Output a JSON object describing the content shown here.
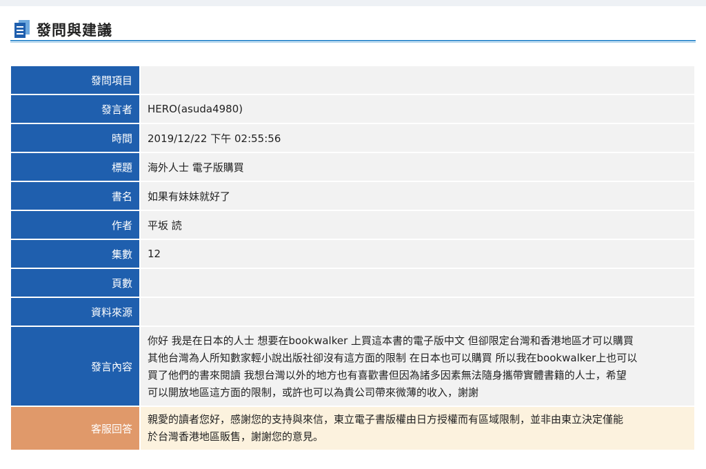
{
  "page": {
    "title": "發問與建議",
    "title_icon": "document-icon"
  },
  "colors": {
    "label_bg": "#1f5fae",
    "reply_label_bg": "#e0996a",
    "reply_value_bg": "#fcf2de",
    "accent_rule": "#3a8fcf"
  },
  "rows": [
    {
      "label": "發問項目",
      "value": ""
    },
    {
      "label": "發言者",
      "value": "HERO(asuda4980)"
    },
    {
      "label": "時間",
      "value": "2019/12/22 下午 02:55:56"
    },
    {
      "label": "標題",
      "value": "海外人士 電子版購買"
    },
    {
      "label": "書名",
      "value": "如果有妹妹就好了"
    },
    {
      "label": "作者",
      "value": "平坂 読"
    },
    {
      "label": "集數",
      "value": "12"
    },
    {
      "label": "頁數",
      "value": ""
    },
    {
      "label": "資料來源",
      "value": ""
    }
  ],
  "content": {
    "label": "發言內容",
    "lines": [
      "你好 我是在日本的人士 想要在bookwalker 上買這本書的電子版中文 但卻限定台灣和香港地區才可以購買",
      "其他台灣為人所知數家輕小說出版社卻沒有這方面的限制 在日本也可以購買 所以我在bookwalker上也可以",
      "買了他們的書來閱讀 我想台灣以外的地方也有喜歡書但因為諸多因素無法隨身攜帶實體書籍的人士，希望",
      "可以開放地區這方面的限制，或許也可以為貴公司帶來微薄的收入，謝謝"
    ]
  },
  "reply": {
    "label": "客服回答",
    "lines": [
      "親愛的讀者您好，感謝您的支持與來信，東立電子書版權由日方授權而有區域限制，並非由東立決定僅能",
      "於台灣香港地區販售，謝謝您的意見。"
    ]
  }
}
